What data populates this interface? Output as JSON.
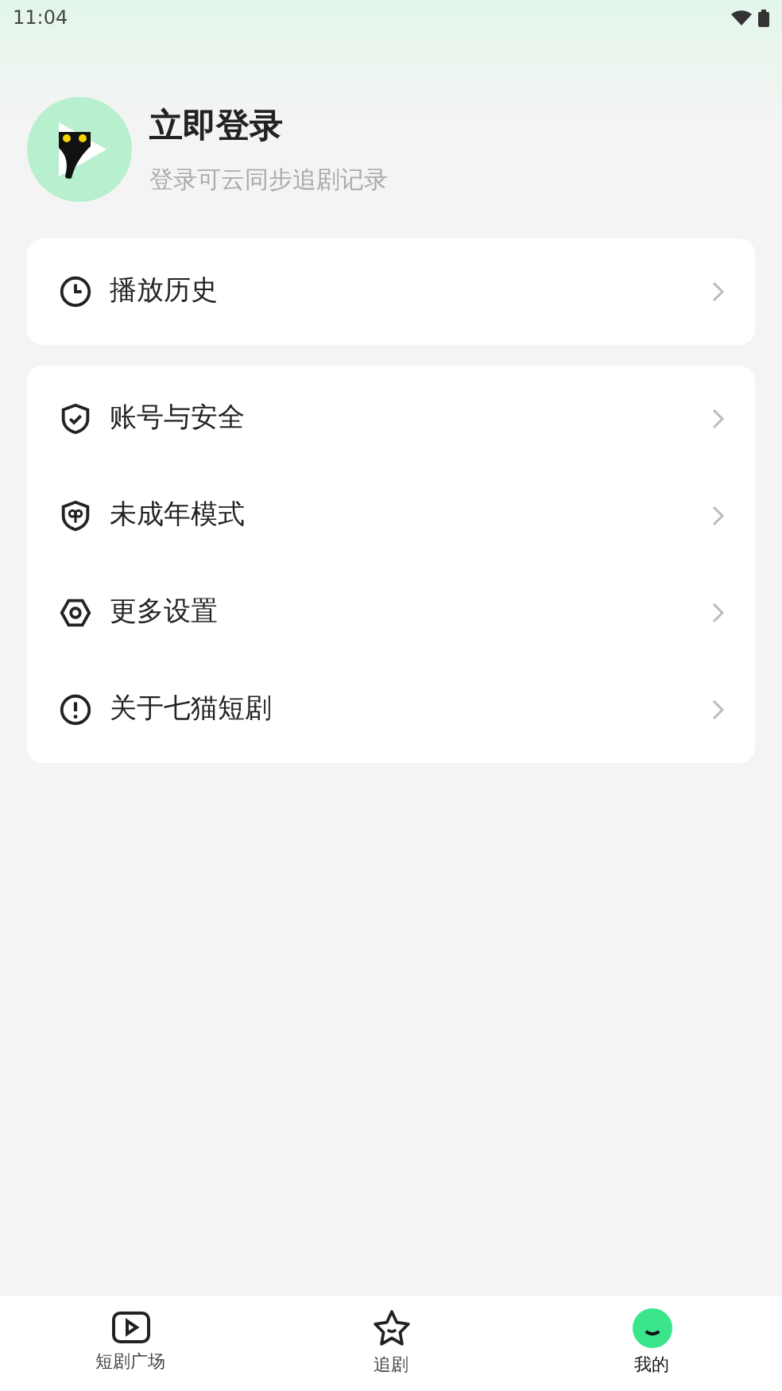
{
  "status_bar": {
    "time": "11:04"
  },
  "profile": {
    "title": "立即登录",
    "subtitle": "登录可云同步追剧记录"
  },
  "menu_groups": [
    {
      "items": [
        {
          "kind": "clock",
          "label": "播放历史"
        }
      ]
    },
    {
      "items": [
        {
          "kind": "shield",
          "label": "账号与安全"
        },
        {
          "kind": "child",
          "label": "未成年模式"
        },
        {
          "kind": "gear",
          "label": "更多设置"
        },
        {
          "kind": "info",
          "label": "关于七猫短剧"
        }
      ]
    }
  ],
  "tabs": [
    {
      "kind": "play",
      "label": "短剧广场",
      "selected": false
    },
    {
      "kind": "star",
      "label": "追剧",
      "selected": false
    },
    {
      "kind": "me",
      "label": "我的",
      "selected": true
    }
  ]
}
